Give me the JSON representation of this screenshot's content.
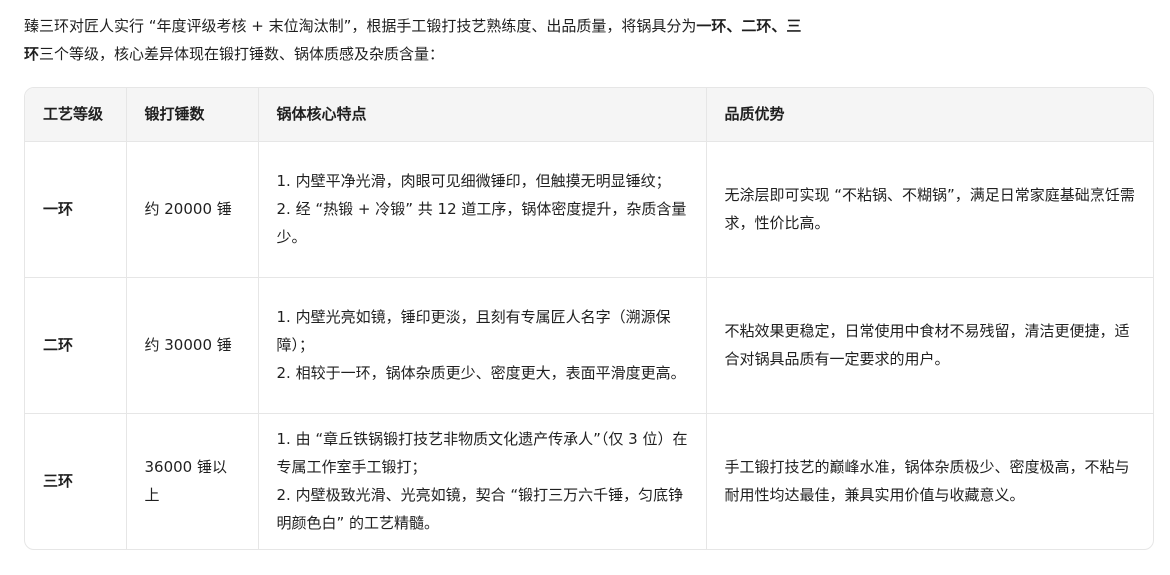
{
  "intro": {
    "part1": "臻三环对匠人实行 “年度评级考核 + 末位淘汰制”，根据手工锻打技艺熟练度、出品质量，将锅具分为",
    "bold1": "一环、二环、三环",
    "part2": "三个等级，核心差异体现在锻打锤数、锅体质感及杂质含量："
  },
  "table": {
    "headers": [
      "工艺等级",
      "锻打锤数",
      "锅体核心特点",
      "品质优势"
    ],
    "rows": [
      {
        "level": "一环",
        "hammers": "约 20000 锤",
        "features": [
          "1. 内壁平净光滑，肉眼可见细微锤印，但触摸无明显锤纹；",
          "2. 经 “热锻 + 冷锻” 共 12 道工序，锅体密度提升，杂质含量少。"
        ],
        "advantage": "无涂层即可实现 “不粘锅、不糊锅”，满足日常家庭基础烹饪需求，性价比高。"
      },
      {
        "level": "二环",
        "hammers": "约 30000 锤",
        "features": [
          "1. 内壁光亮如镜，锤印更淡，且刻有专属匠人名字（溯源保障）；",
          "2. 相较于一环，锅体杂质更少、密度更大，表面平滑度更高。"
        ],
        "advantage": "不粘效果更稳定，日常使用中食材不易残留，清洁更便捷，适合对锅具品质有一定要求的用户。"
      },
      {
        "level": "三环",
        "hammers": "36000 锤以上",
        "features": [
          "1. 由 “章丘铁锅锻打技艺非物质文化遗产传承人”（仅 3 位）在专属工作室手工锻打；",
          "2. 内壁极致光滑、光亮如镜，契合 “锻打三万六千锤，匀底铮明颜色白” 的工艺精髓。"
        ],
        "advantage": "手工锻打技艺的巅峰水准，锅体杂质极少、密度极高，不粘与耐用性均达最佳，兼具实用价值与收藏意义。"
      }
    ]
  }
}
